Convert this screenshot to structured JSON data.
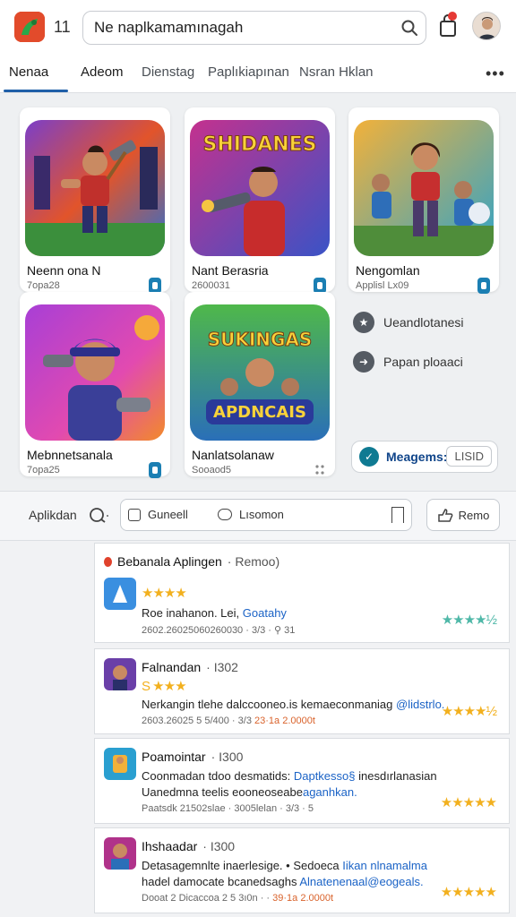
{
  "header": {
    "count": "11",
    "search_value": "Ne naplkamamınagah",
    "colors": {
      "accent": "#1f5fa8",
      "logo": "#e24b2b",
      "badge": "#e53935"
    }
  },
  "tabs": [
    {
      "label": "Nenaa"
    },
    {
      "label": "Adeom"
    },
    {
      "label": "Dienstag"
    },
    {
      "label": "Paplıkiapınan"
    },
    {
      "label": "Nsran Hklan"
    }
  ],
  "cards": [
    {
      "title": "Neenn ona N",
      "sub": "7opa28",
      "icon": "hero-with-hammer"
    },
    {
      "title": "Nant Berasria",
      "sub": "2600031",
      "icon": "shidanes-blaster",
      "art_text": "SHIDANES"
    },
    {
      "title": "Nengomlan",
      "sub": "Applisl Lx09",
      "icon": "fighters-team"
    },
    {
      "title": "Mebnnetsanala",
      "sub": "7opa25",
      "icon": "cap-hero-with-gun"
    },
    {
      "title": "Nanlatsolanaw",
      "sub": "Sooaod5",
      "icon": "sukingas-group",
      "art_text": "SUKINGAS",
      "art_text2": "APDNCAIS"
    }
  ],
  "side": {
    "item1": "Ueandlotanesi",
    "item2": "Papan ploaaci",
    "badge_label": "Meagems:",
    "badge_value": "LISID"
  },
  "filter": {
    "label": "Aplikdan",
    "chip1": "Guneell",
    "chip2": "Lısomon",
    "refine": "Remo"
  },
  "reviews": [
    {
      "title": "Bebanala Aplingen",
      "suffix": "· Remoo)",
      "stars": "★★★★",
      "text": "Roe inahanon. Lei,",
      "link": "Goatahy",
      "meta": "2602.26025060260030 · 3/3 · ⚲ 31",
      "right_stars": "★★★★½"
    },
    {
      "title": "Falnandan",
      "suffix": "· I302",
      "stars": "S ★★★",
      "text": "Nerkangin tlehe dalccooneo.is kemaeconmaniag",
      "link": "@lidstrlo.",
      "meta": "2603.26025 5 5/400 · 3/3",
      "date": "23·1a 2.0000t",
      "right_stars": "★★★★½"
    },
    {
      "title": "Poamointar",
      "suffix": "· I300",
      "text1": "Coonmadan tdoo desmatids:",
      "link1": "Daptkesso§",
      "text1b": "inesdırlanasian",
      "text2": "Uanedmna teelis eooneoseabe",
      "link2": "aganhkan.",
      "meta": "Paatsdk 21502slae · 3005lelan · 3/3 · 5",
      "right_stars": "★★★★★"
    },
    {
      "title": "Ihshaadar",
      "suffix": "· I300",
      "text1": "Detasagemnlte inaerlesige.",
      "text1b": "• Sedoeca",
      "link1": "Iikan nlnamalma",
      "text2": "hadel damocate bcanedsaghs",
      "link2": "Alnatenenaal@eogeals.",
      "meta": "Dooat 2 Dicaccoa 2 5 3ı0n · ·",
      "date": "39·1a 2.0000t",
      "right_stars": "★★★★★"
    }
  ]
}
